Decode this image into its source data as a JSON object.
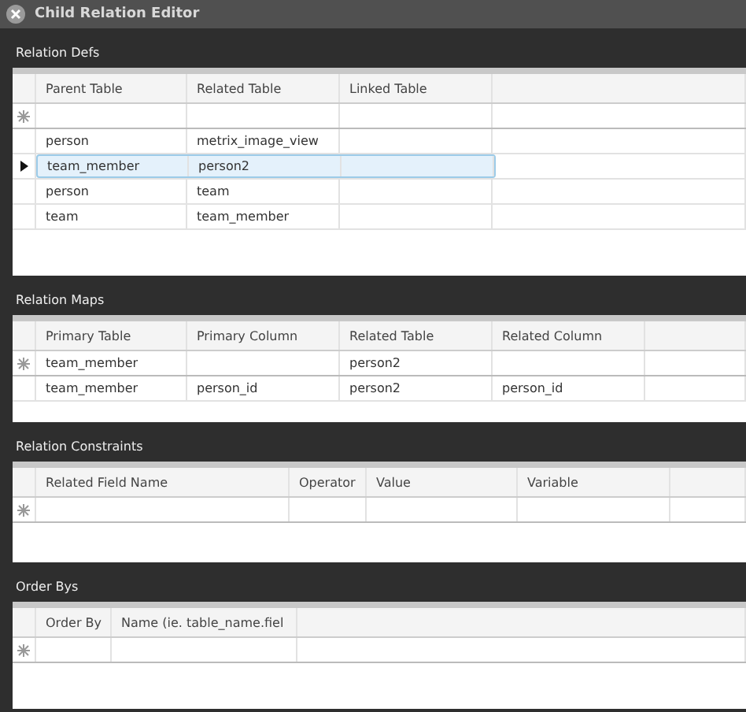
{
  "window": {
    "title": "Child Relation Editor"
  },
  "sections": [
    {
      "title": "Relation Defs",
      "columns": [
        "Parent Table",
        "Related Table",
        "Linked Table"
      ],
      "rows": [
        {
          "kind": "new",
          "selected": false,
          "cells": [
            "",
            "",
            ""
          ]
        },
        {
          "kind": "data",
          "selected": false,
          "cells": [
            "person",
            "metrix_image_view",
            ""
          ]
        },
        {
          "kind": "data",
          "selected": true,
          "cells": [
            "team_member",
            "person2",
            ""
          ]
        },
        {
          "kind": "data",
          "selected": false,
          "cells": [
            "person",
            "team",
            ""
          ]
        },
        {
          "kind": "data",
          "selected": false,
          "cells": [
            "team",
            "team_member",
            ""
          ]
        }
      ]
    },
    {
      "title": "Relation Maps",
      "columns": [
        "Primary Table",
        "Primary Column",
        "Related Table",
        "Related Column"
      ],
      "rows": [
        {
          "kind": "new",
          "selected": false,
          "cells": [
            "team_member",
            "",
            "person2",
            ""
          ]
        },
        {
          "kind": "data",
          "selected": false,
          "cells": [
            "team_member",
            "person_id",
            "person2",
            "person_id"
          ]
        }
      ]
    },
    {
      "title": "Relation Constraints",
      "columns": [
        "Related Field Name",
        "Operator",
        "Value",
        "Variable"
      ],
      "rows": [
        {
          "kind": "new",
          "selected": false,
          "cells": [
            "",
            "",
            "",
            ""
          ]
        }
      ]
    },
    {
      "title": "Order Bys",
      "columns": [
        "Order By",
        "Name (ie. table_name.fiel"
      ],
      "rows": [
        {
          "kind": "new",
          "selected": false,
          "cells": [
            "",
            ""
          ]
        }
      ]
    }
  ]
}
